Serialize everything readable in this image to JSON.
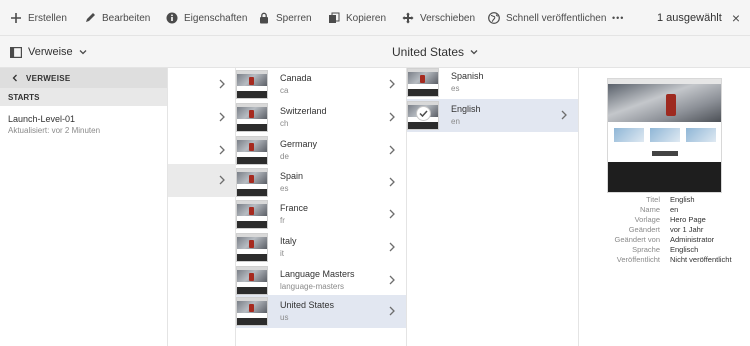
{
  "toolbar": {
    "create": "Erstellen",
    "edit": "Bearbeiten",
    "properties": "Eigenschaften",
    "lock": "Sperren",
    "copy": "Kopieren",
    "move": "Verschieben",
    "quick_publish": "Schnell veröffentlichen",
    "more": "•••",
    "selected": "1 ausgewählt",
    "close": "×"
  },
  "subbar": {
    "view_label": "Verweise",
    "location_title": "United States"
  },
  "rail": {
    "back_label": "VERWEISE",
    "section_label": "STARTS",
    "entry_title": "Launch-Level-01",
    "entry_subtitle": "Aktualisiert: vor 2 Minuten"
  },
  "column2": {
    "items": [
      {
        "name": "Canada",
        "code": "ca"
      },
      {
        "name": "Switzerland",
        "code": "ch"
      },
      {
        "name": "Germany",
        "code": "de"
      },
      {
        "name": "Spain",
        "code": "es"
      },
      {
        "name": "France",
        "code": "fr"
      },
      {
        "name": "Italy",
        "code": "it"
      },
      {
        "name": "Language Masters",
        "code": "language-masters"
      },
      {
        "name": "United States",
        "code": "us"
      }
    ]
  },
  "column3": {
    "items": [
      {
        "name": "Spanish",
        "code": "es"
      },
      {
        "name": "English",
        "code": "en"
      }
    ]
  },
  "preview": {
    "properties": [
      {
        "key": "Titel",
        "value": "English"
      },
      {
        "key": "Name",
        "value": "en"
      },
      {
        "key": "Vorlage",
        "value": "Hero Page"
      },
      {
        "key": "Geändert",
        "value": "vor 1 Jahr"
      },
      {
        "key": "Geändert von",
        "value": "Administrator"
      },
      {
        "key": "Sprache",
        "value": "Englisch"
      },
      {
        "key": "Veröffentlicht",
        "value": "Nicht veröffentlicht"
      }
    ]
  },
  "colors": {
    "toolbar_bg": "#f5f5f5",
    "selected_row": "#e2e7f1",
    "text": "#323232"
  }
}
